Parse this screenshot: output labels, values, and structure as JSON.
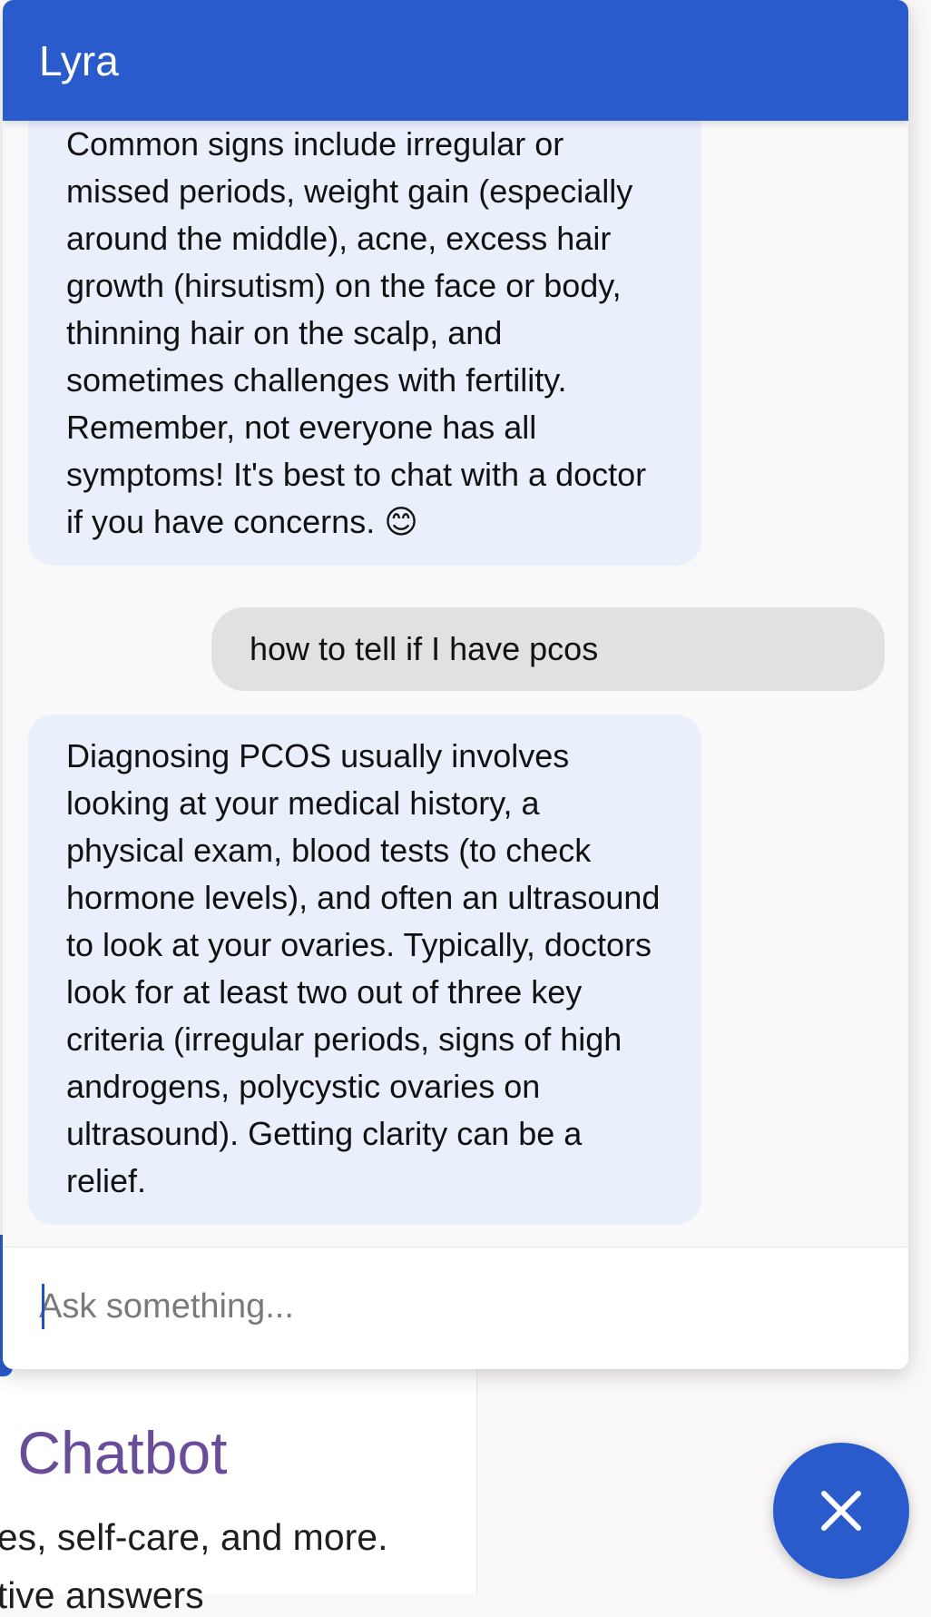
{
  "background_page": {
    "title": "c Chatbot",
    "subtitle": "nes, self-care, and more.",
    "subtitle2": "ative answers"
  },
  "chat": {
    "title": "Lyra",
    "messages": [
      {
        "role": "bot",
        "text": "Common signs include irregular or missed periods, weight gain (especially around the middle), acne, excess hair growth (hirsutism) on the face or body, thinning hair on the scalp, and sometimes challenges with fertility. Remember, not everyone has all symptoms! It's best to chat with a doctor if you have concerns. 😊"
      },
      {
        "role": "user",
        "text": "how to tell if I have pcos"
      },
      {
        "role": "bot",
        "text": "Diagnosing PCOS usually involves looking at your medical history, a physical exam, blood tests (to check hormone levels), and often an ultrasound to look at your ovaries. Typically, doctors look for at least two out of three key criteria (irregular periods, signs of high androgens, polycystic ovaries on ultrasound). Getting clarity can be a relief."
      }
    ],
    "input": {
      "placeholder": "Ask something...",
      "value": ""
    }
  },
  "fab": {
    "icon": "close-icon"
  },
  "colors": {
    "primary": "#2a5bcc",
    "bot_bubble": "#e9f0fb",
    "user_bubble": "#e1e1df",
    "background_title": "#6a4d9a"
  }
}
